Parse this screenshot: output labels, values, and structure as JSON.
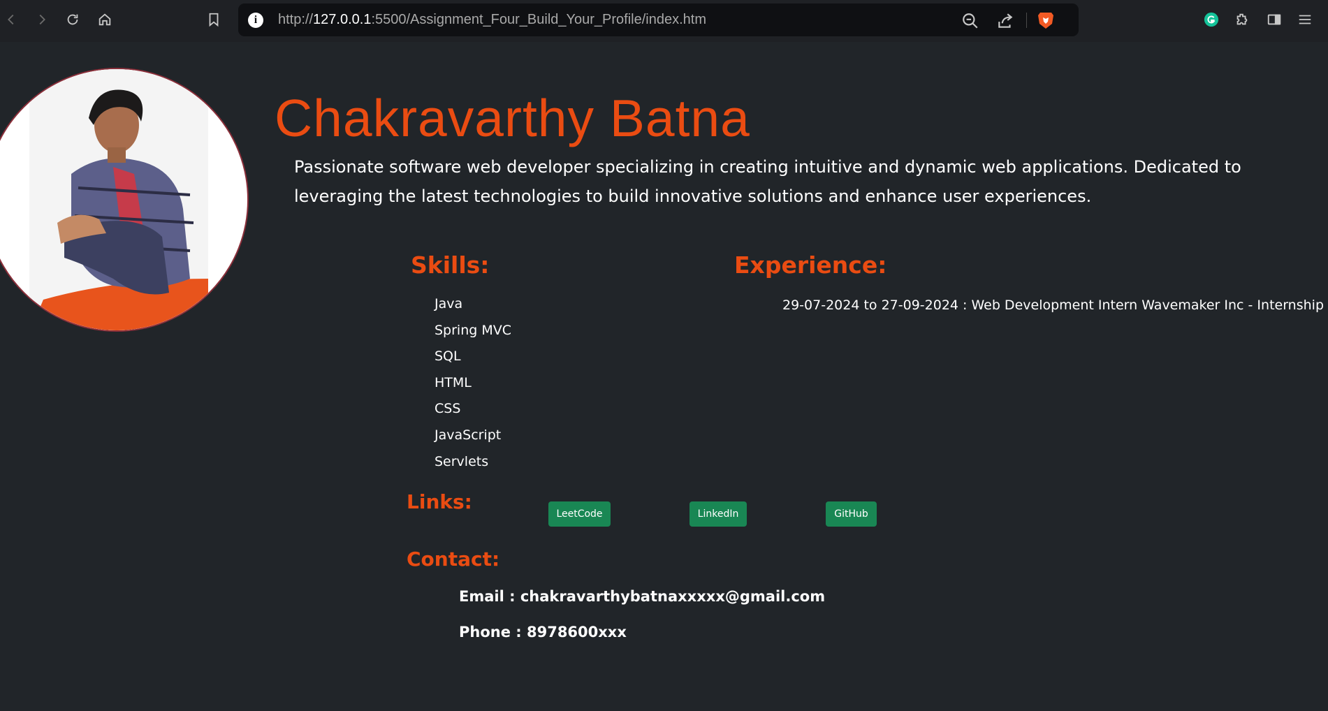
{
  "browser": {
    "url_prefix": "http://",
    "url_host": "127.0.0.1",
    "url_rest": ":5500/Assignment_Four_Build_Your_Profile/index.htm"
  },
  "profile": {
    "name": "Chakravarthy Batna",
    "bio": "Passionate software web developer specializing in creating intuitive and dynamic web applications. Dedicated to leveraging the latest technologies to build innovative solutions and enhance user experiences."
  },
  "skills": {
    "title": "Skills:",
    "items": [
      "Java",
      "Spring MVC",
      "SQL",
      "HTML",
      "CSS",
      "JavaScript",
      "Servlets"
    ]
  },
  "experience": {
    "title": "Experience:",
    "items": [
      "29-07-2024 to 27-09-2024 : Web Development Intern Wavemaker Inc - Internship"
    ]
  },
  "links": {
    "title": "Links:",
    "buttons": [
      "LeetCode",
      "LinkedIn",
      "GitHub"
    ]
  },
  "contact": {
    "title": "Contact:",
    "email": "Email : chakravarthybatnaxxxxx@gmail.com",
    "phone": "Phone : 8978600xxx"
  },
  "colors": {
    "background": "#212529",
    "accent": "#ea4c12",
    "button": "#198754"
  }
}
